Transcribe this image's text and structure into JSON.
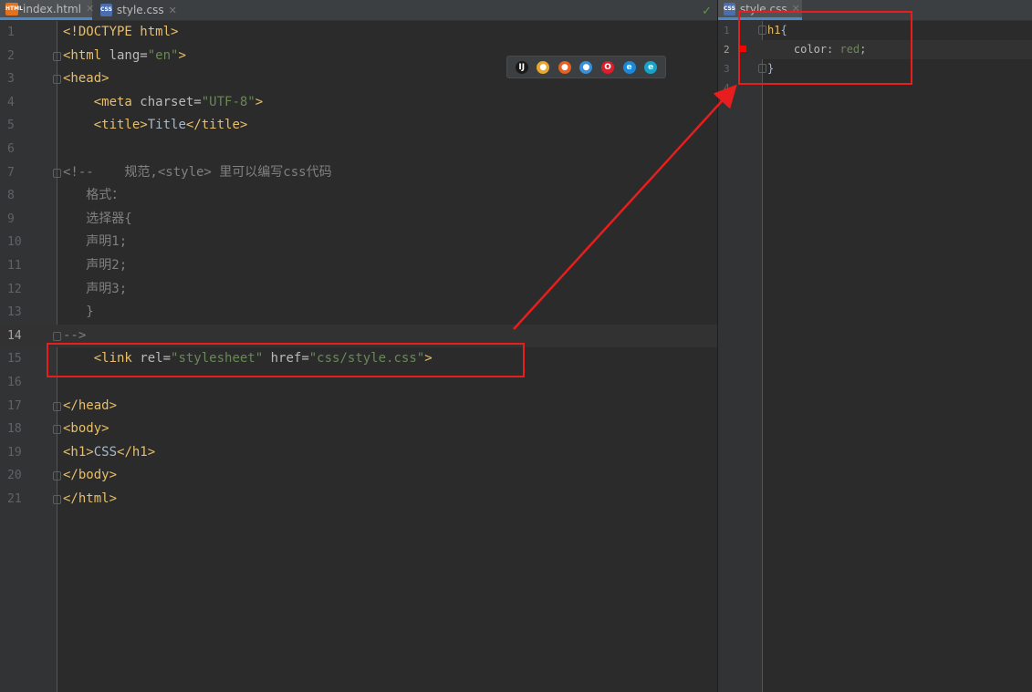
{
  "left_editor": {
    "tabs": [
      {
        "label": "index.html",
        "icon": "html-file-icon",
        "active": true
      },
      {
        "label": "style.css",
        "icon": "css-file-icon",
        "active": false
      }
    ],
    "lines": [
      {
        "n": "1",
        "parts": [
          [
            "tag",
            "<!DOCTYPE "
          ],
          [
            "tag",
            "html"
          ],
          [
            "tag",
            ">"
          ]
        ]
      },
      {
        "n": "2",
        "parts": [
          [
            "tag",
            "<html "
          ],
          [
            "attr",
            "lang="
          ],
          [
            "val",
            "\"en\""
          ],
          [
            "tag",
            ">"
          ]
        ]
      },
      {
        "n": "3",
        "parts": [
          [
            "tag",
            "<head>"
          ]
        ]
      },
      {
        "n": "4",
        "parts": [
          [
            "txt",
            "    "
          ],
          [
            "tag",
            "<meta "
          ],
          [
            "attr",
            "charset="
          ],
          [
            "val",
            "\"UTF-8\""
          ],
          [
            "tag",
            ">"
          ]
        ]
      },
      {
        "n": "5",
        "parts": [
          [
            "txt",
            "    "
          ],
          [
            "tag",
            "<title>"
          ],
          [
            "txt",
            "Title"
          ],
          [
            "tag",
            "</title>"
          ]
        ]
      },
      {
        "n": "6",
        "parts": []
      },
      {
        "n": "7",
        "parts": [
          [
            "cmt",
            "<!--    规范,<style> 里可以编写css代码"
          ]
        ]
      },
      {
        "n": "8",
        "parts": [
          [
            "cmt",
            "   格式："
          ]
        ]
      },
      {
        "n": "9",
        "parts": [
          [
            "cmt",
            "   选择器{"
          ]
        ]
      },
      {
        "n": "10",
        "parts": [
          [
            "cmt",
            "   声明1;"
          ]
        ]
      },
      {
        "n": "11",
        "parts": [
          [
            "cmt",
            "   声明2;"
          ]
        ]
      },
      {
        "n": "12",
        "parts": [
          [
            "cmt",
            "   声明3;"
          ]
        ]
      },
      {
        "n": "13",
        "parts": [
          [
            "cmt",
            "   }"
          ]
        ]
      },
      {
        "n": "14",
        "parts": [
          [
            "cmt",
            "-->"
          ]
        ]
      },
      {
        "n": "15",
        "parts": [
          [
            "txt",
            "    "
          ],
          [
            "tag",
            "<link "
          ],
          [
            "attr",
            "rel="
          ],
          [
            "val",
            "\"stylesheet\""
          ],
          [
            "attr",
            " href="
          ],
          [
            "val",
            "\"css/style.css\""
          ],
          [
            "tag",
            ">"
          ]
        ]
      },
      {
        "n": "16",
        "parts": []
      },
      {
        "n": "17",
        "parts": [
          [
            "tag",
            "</head>"
          ]
        ]
      },
      {
        "n": "18",
        "parts": [
          [
            "tag",
            "<body>"
          ]
        ]
      },
      {
        "n": "19",
        "parts": [
          [
            "tag",
            "<h1>"
          ],
          [
            "txt",
            "CSS"
          ],
          [
            "tag",
            "</h1>"
          ]
        ]
      },
      {
        "n": "20",
        "parts": [
          [
            "tag",
            "</body>"
          ]
        ]
      },
      {
        "n": "21",
        "parts": [
          [
            "tag",
            "</html>"
          ]
        ]
      }
    ],
    "current_line": "14",
    "folds": [
      "2",
      "3",
      "7",
      "14",
      "17",
      "18",
      "20",
      "21"
    ]
  },
  "browser_icons": [
    {
      "name": "intellij-icon",
      "glyph": "IJ",
      "color": "#1a1a1a"
    },
    {
      "name": "chrome-icon",
      "glyph": "●",
      "color": "#e8a72b"
    },
    {
      "name": "firefox-icon",
      "glyph": "●",
      "color": "#e66020"
    },
    {
      "name": "safari-icon",
      "glyph": "●",
      "color": "#3b8ed8"
    },
    {
      "name": "opera-icon",
      "glyph": "O",
      "color": "#d81f2a"
    },
    {
      "name": "ie-icon",
      "glyph": "e",
      "color": "#1e88d8"
    },
    {
      "name": "edge-icon",
      "glyph": "e",
      "color": "#1aa1c7"
    }
  ],
  "right_editor": {
    "tab": {
      "label": "style.css",
      "icon": "css-file-icon"
    },
    "lines": [
      {
        "n": "1",
        "parts": [
          [
            "csssel",
            "h1"
          ],
          [
            "txt",
            "{"
          ]
        ]
      },
      {
        "n": "2",
        "parts": [
          [
            "txt",
            "    "
          ],
          [
            "cssprop",
            "color"
          ],
          [
            "txt",
            ": "
          ],
          [
            "cssval",
            "red"
          ],
          [
            "txt",
            ";"
          ]
        ]
      },
      {
        "n": "3",
        "parts": [
          [
            "txt",
            "}"
          ]
        ]
      },
      {
        "n": "4",
        "parts": []
      }
    ],
    "current_line": "2",
    "folds": [
      "1",
      "3"
    ],
    "color_marker": "#ff0000"
  },
  "annotation_color": "#e81d1d"
}
